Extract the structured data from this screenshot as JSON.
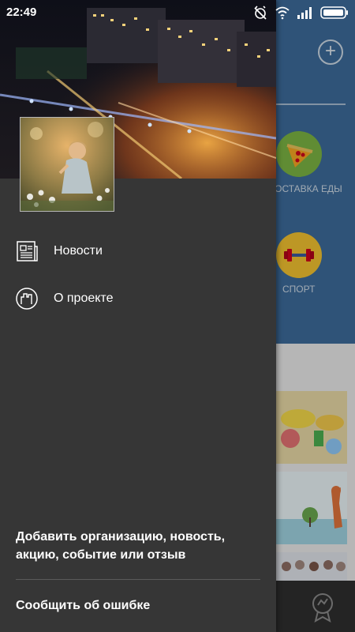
{
  "status_bar": {
    "time": "22:49",
    "icons": [
      "alarm-off-icon",
      "wifi-icon",
      "signal-icon",
      "battery-icon"
    ]
  },
  "background_screen": {
    "categories": [
      {
        "label": "ДОСТАВКА ЕДЫ",
        "icon": "pizza-icon",
        "color": "#7bb443"
      },
      {
        "label": "СПОРТ",
        "icon": "dumbbell-icon",
        "color": "#f2c230"
      }
    ],
    "header_color": "#3d6b9a",
    "bottom_nav_icon": "badge-icon"
  },
  "drawer": {
    "menu": [
      {
        "label": "Новости",
        "icon": "newspaper-icon"
      },
      {
        "label": "О проекте",
        "icon": "city-icon"
      }
    ],
    "add_organization": "Добавить организацию, новость, акцию, событие или отзыв",
    "report_error": "Сообщить об ошибке",
    "background_color": "#363636"
  }
}
